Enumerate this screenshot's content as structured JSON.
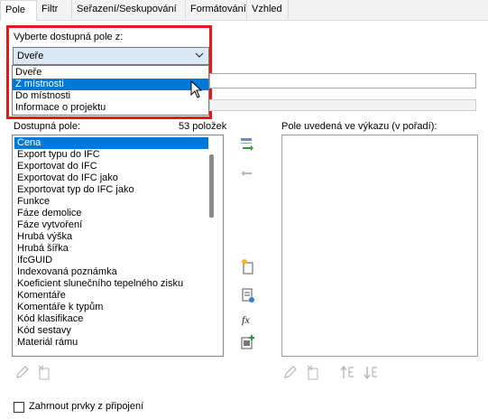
{
  "tabs": [
    "Pole",
    "Filtr",
    "Seřazení/Seskupování",
    "Formátování",
    "Vzhled"
  ],
  "available_from": {
    "label": "Vyberte dostupná pole z:",
    "selected": "Dveře",
    "options": [
      "Dveře",
      "Z místnosti",
      "Do místnosti",
      "Informace o projektu"
    ],
    "highlighted_index": 1
  },
  "available_fields": {
    "label": "Dostupná pole:",
    "count": "53 položek",
    "items": [
      "Cena",
      "Export typu do IFC",
      "Exportovat do IFC",
      "Exportovat do IFC jako",
      "Exportovat typ do IFC jako",
      "Funkce",
      "Fáze demolice",
      "Fáze vytvoření",
      "Hrubá výška",
      "Hrubá šířka",
      "IfcGUID",
      "Indexovaná poznámka",
      "Koeficient slunečního tepelného zisku",
      "Komentáře",
      "Komentáře k typům",
      "Kód klasifikace",
      "Kód sestavy",
      "Materiál rámu"
    ],
    "selected_index": 0
  },
  "scheduled_fields": {
    "label": "Pole uvedená ve výkazu (v pořadí):",
    "items": []
  },
  "include_linked": {
    "label": "Zahrnout prvky z připojení",
    "checked": false
  },
  "colors": {
    "highlight": "#0078d7",
    "annotation_box": "#e11b1b",
    "combo_fill": "#dbe8f5"
  },
  "icons": {
    "add_parameter": "add-parameter-icon",
    "remove_parameter": "remove-parameter-icon",
    "new_parameter": "new-parameter-icon",
    "combine_parameters": "combine-parameters-icon",
    "calculated_value": "calculated-value-icon",
    "add_shared": "add-shared-parameter-icon",
    "edit": "edit-icon",
    "delete": "delete-icon",
    "move_up": "move-up-icon",
    "move_down": "move-down-icon"
  }
}
